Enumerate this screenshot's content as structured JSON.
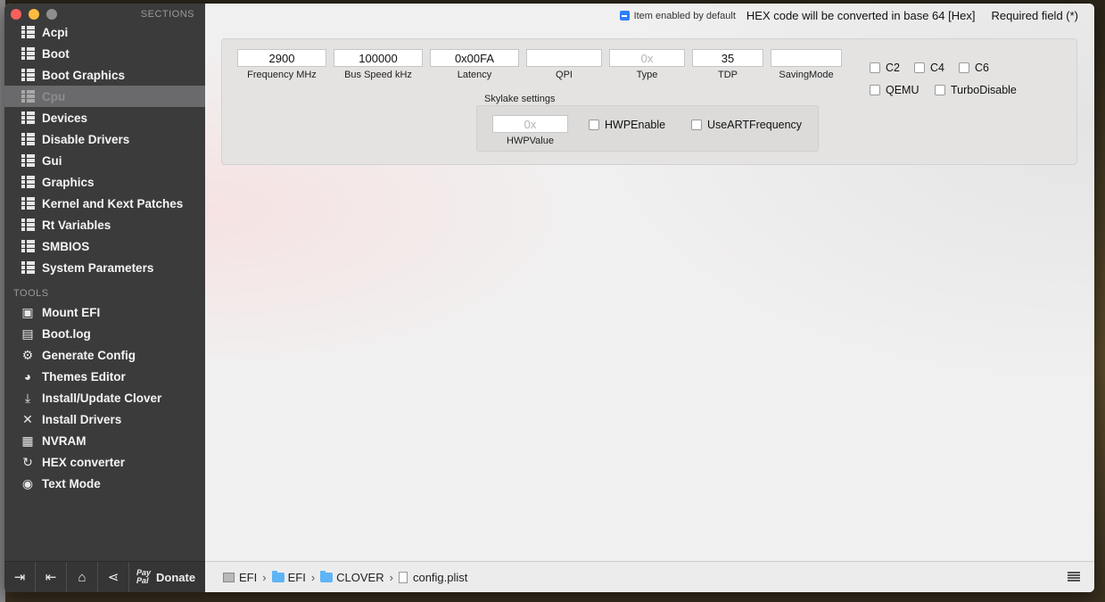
{
  "sidebar": {
    "sections_header": "SECTIONS",
    "sections": [
      {
        "label": "Acpi",
        "icon": "list-icon"
      },
      {
        "label": "Boot",
        "icon": "list-icon"
      },
      {
        "label": "Boot Graphics",
        "icon": "list-icon"
      },
      {
        "label": "Cpu",
        "icon": "list-icon",
        "selected": true
      },
      {
        "label": "Devices",
        "icon": "list-icon"
      },
      {
        "label": "Disable Drivers",
        "icon": "list-icon"
      },
      {
        "label": "Gui",
        "icon": "list-icon"
      },
      {
        "label": "Graphics",
        "icon": "list-icon"
      },
      {
        "label": "Kernel and Kext Patches",
        "icon": "list-icon"
      },
      {
        "label": "Rt Variables",
        "icon": "list-icon"
      },
      {
        "label": "SMBIOS",
        "icon": "list-icon"
      },
      {
        "label": "System Parameters",
        "icon": "list-icon"
      }
    ],
    "tools_header": "TOOLS",
    "tools": [
      {
        "label": "Mount EFI",
        "icon": "disk-icon"
      },
      {
        "label": "Boot.log",
        "icon": "log-icon"
      },
      {
        "label": "Generate Config",
        "icon": "gears-icon"
      },
      {
        "label": "Themes Editor",
        "icon": "palette-icon"
      },
      {
        "label": "Install/Update Clover",
        "icon": "download-icon"
      },
      {
        "label": "Install Drivers",
        "icon": "wrench-icon"
      },
      {
        "label": "NVRAM",
        "icon": "chip-icon"
      },
      {
        "label": "HEX converter",
        "icon": "refresh-icon"
      },
      {
        "label": "Text Mode",
        "icon": "eye-icon"
      }
    ],
    "bottom": {
      "donate_label": "Donate",
      "paypal_line1": "Pay",
      "paypal_line2": "Pal"
    }
  },
  "topbar": {
    "legend_text": "Item enabled by default",
    "hex_note": "HEX code will be converted in base 64 [Hex]",
    "required_note": "Required field (*)",
    "legend_color": "#2d7ff9"
  },
  "cpu": {
    "frequency": {
      "label": "Frequency MHz",
      "value": "2900"
    },
    "bus_speed": {
      "label": "Bus Speed kHz",
      "value": "100000"
    },
    "latency": {
      "label": "Latency",
      "value": "0x00FA"
    },
    "qpi": {
      "label": "QPI",
      "value": ""
    },
    "type": {
      "label": "Type",
      "value": "",
      "placeholder": "0x"
    },
    "tdp": {
      "label": "TDP",
      "value": "35"
    },
    "saving_mode": {
      "label": "SavingMode",
      "value": ""
    },
    "checkboxes": {
      "c2": {
        "label": "C2",
        "checked": false
      },
      "c4": {
        "label": "C4",
        "checked": false
      },
      "c6": {
        "label": "C6",
        "checked": false
      },
      "qemu": {
        "label": "QEMU",
        "checked": false
      },
      "turbo_disable": {
        "label": "TurboDisable",
        "checked": false
      }
    },
    "skylake": {
      "title": "Skylake settings",
      "hwp_value": {
        "label": "HWPValue",
        "value": "",
        "placeholder": "0x"
      },
      "hwp_enable": {
        "label": "HWPEnable",
        "checked": false
      },
      "use_art_frequency": {
        "label": "UseARTFrequency",
        "checked": false
      }
    }
  },
  "pathbar": {
    "crumbs": [
      "EFI",
      "EFI",
      "CLOVER",
      "config.plist"
    ],
    "separator": "›"
  }
}
